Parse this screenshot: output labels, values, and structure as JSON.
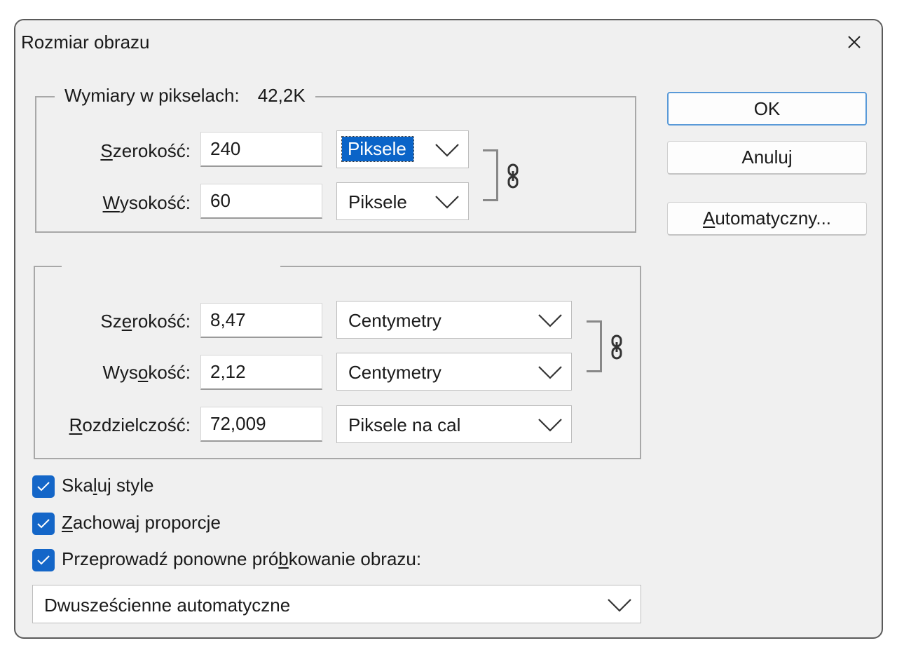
{
  "window": {
    "title": "Rozmiar obrazu"
  },
  "pixel_dimensions": {
    "legend": "Wymiary w pikselach:",
    "size": "42,2K",
    "width": {
      "label_ul": "S",
      "label_rest": "zerokość:",
      "value": "240",
      "unit": "Piksele"
    },
    "height": {
      "label_ul": "W",
      "label_rest": "ysokość:",
      "value": "60",
      "unit": "Piksele"
    }
  },
  "document_size": {
    "width": {
      "label_pre": "Sz",
      "label_ul": "e",
      "label_rest": "rokość:",
      "value": "8,47",
      "unit": "Centymetry"
    },
    "height": {
      "label_pre": "Wys",
      "label_ul": "o",
      "label_rest": "kość:",
      "value": "2,12",
      "unit": "Centymetry"
    },
    "resolution": {
      "label_ul": "R",
      "label_rest": "ozdzielczość:",
      "value": "72,009",
      "unit": "Piksele na cal"
    }
  },
  "buttons": {
    "ok": "OK",
    "cancel": "Anuluj",
    "auto_ul": "A",
    "auto_rest": "utomatyczny..."
  },
  "options": {
    "scale_styles": {
      "label_pre": "Ska",
      "label_ul": "l",
      "label_rest": "uj style",
      "checked": true
    },
    "constrain": {
      "label_ul": "Z",
      "label_rest": "achowaj proporcje",
      "checked": true
    },
    "resample": {
      "label_pre": "Przeprowadź ponowne pró",
      "label_ul": "b",
      "label_rest": "kowanie obrazu:",
      "checked": true
    }
  },
  "resample_method": "Dwusześcienne automatyczne",
  "colors": {
    "accent": "#1466c8",
    "dialog_bg": "#f0f0f0",
    "selection": "#0a64c8"
  }
}
